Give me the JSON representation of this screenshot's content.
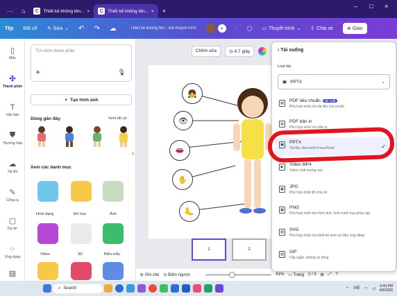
{
  "browser": {
    "tabs": [
      {
        "label": "Thiết kế không tên..."
      },
      {
        "label": "Thiết kế không tên..."
      }
    ],
    "new_tab": "+",
    "window_controls": [
      "–",
      "□",
      "×"
    ]
  },
  "toolbar": {
    "home": "Tệp",
    "file": "Đổi cỡ",
    "edit": "Sửa",
    "undo_icon": "undo-icon",
    "redo_icon": "redo-icon",
    "title": "Thiết kế không tên - Bài thuyết trình",
    "present": "Thuyết trình",
    "share": "Chia sẻ",
    "extra": "Giao"
  },
  "rail": {
    "items": [
      {
        "label": "Mẫu",
        "icon": "template-icon"
      },
      {
        "label": "Thành phần",
        "icon": "elements-icon"
      },
      {
        "label": "Văn bản",
        "icon": "text-icon"
      },
      {
        "label": "Thương hiệu",
        "icon": "brand-icon"
      },
      {
        "label": "Tải lên",
        "icon": "upload-icon"
      },
      {
        "label": "Công cụ",
        "icon": "tools-icon"
      },
      {
        "label": "Dự án",
        "icon": "projects-icon"
      },
      {
        "label": "Ứng dụng",
        "icon": "apps-icon"
      },
      {
        "label": "",
        "icon": "more-icon"
      }
    ]
  },
  "panel": {
    "search_placeholder": "Tìm kiếm thành phần",
    "generate": "Tạo hình ảnh",
    "recent_title": "Dùng gần đây",
    "see_all": "Xem tất cả",
    "categories_title": "Xem các danh mục",
    "categories": [
      {
        "label": "Hình dạng"
      },
      {
        "label": "Đồ họa"
      },
      {
        "label": "Ảnh"
      },
      {
        "label": "Video"
      },
      {
        "label": "3D"
      },
      {
        "label": "Biểu mẫu"
      }
    ]
  },
  "canvas": {
    "edit": "Chỉnh sửa",
    "duration": "4.7 giây",
    "notes": "Ghi chú",
    "timer": "Đếm ngược",
    "zoom": "41%",
    "pages": "Trang",
    "page_count": "2 / 3",
    "page_numbers": [
      "1",
      "2"
    ]
  },
  "download": {
    "title": "Tải xuống",
    "file_type_label": "Loại tệp",
    "selected": "PPTX",
    "options": [
      {
        "name": "PDF tiêu chuẩn",
        "desc": "Phù hợp nhất cho tài liệu (và email)",
        "badge": "Đề xuất"
      },
      {
        "name": "PDF bản in",
        "desc": "Phù hợp nhất cho bản in",
        "badge": ""
      },
      {
        "name": "PPTX",
        "desc": "Tài liệu Microsoft PowerPoint",
        "badge": "",
        "selected": true
      },
      {
        "name": "Video MP4",
        "desc": "Video chất lượng cao",
        "badge": ""
      },
      {
        "name": "JPG",
        "desc": "Phù hợp nhất để chia sẻ",
        "badge": ""
      },
      {
        "name": "PNG",
        "desc": "Phù hợp nhất cho hình ảnh, hình minh họa phức tạp",
        "badge": ""
      },
      {
        "name": "SVG",
        "desc": "Phù hợp nhất cho thiết kế web và hiệu ứng động",
        "badge": ""
      },
      {
        "name": "GIF",
        "desc": "Clip ngắn, không có tiếng",
        "badge": ""
      }
    ]
  },
  "taskbar": {
    "search": "Search",
    "time": "9:43 PM",
    "date": "4/6/2026",
    "lang": "VIE"
  },
  "colors": {
    "toolbar_start": "#2c8bd6",
    "toolbar_end": "#7a3cd4",
    "annotation_red": "#e0151f",
    "accent": "#3d46d6"
  }
}
